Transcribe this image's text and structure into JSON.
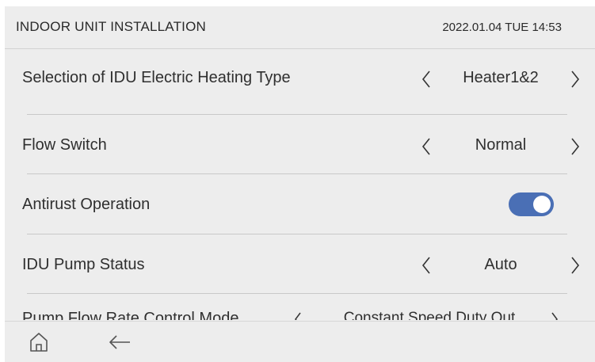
{
  "header": {
    "title": "INDOOR UNIT INSTALLATION",
    "datetime": "2022.01.04 TUE 14:53"
  },
  "settings": [
    {
      "label": "Selection of IDU Electric Heating Type",
      "value": "Heater1&2",
      "control": "selector"
    },
    {
      "label": "Flow Switch",
      "value": "Normal",
      "control": "selector"
    },
    {
      "label": "Antirust Operation",
      "control": "toggle",
      "enabled": true
    },
    {
      "label": "IDU Pump Status",
      "value": "Auto",
      "control": "selector"
    },
    {
      "label": "Pump Flow Rate Control Mode",
      "value": "Constant Speed Duty Out",
      "control": "selector"
    }
  ],
  "icons": {
    "prev": "chevron-left-icon",
    "next": "chevron-right-icon",
    "home": "home-icon",
    "back": "back-arrow-icon"
  },
  "colors": {
    "background": "#ededed",
    "toggle_on": "#4a6fb5",
    "text": "#2f2f2f",
    "divider": "#c9c9c9"
  }
}
